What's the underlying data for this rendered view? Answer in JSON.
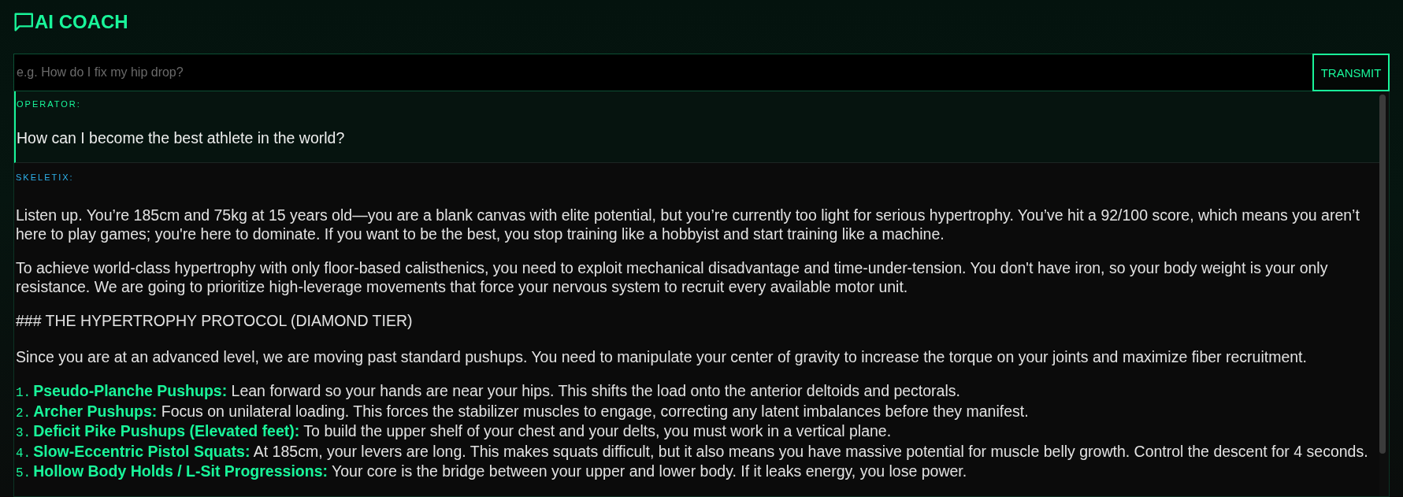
{
  "header": {
    "title": "AI COACH"
  },
  "composer": {
    "placeholder": "e.g. How do I fix my hip drop?",
    "button": "TRANSMIT"
  },
  "messages": [
    {
      "kind": "operator",
      "sender": "OPERATOR:",
      "blocks": [
        {
          "kind": "paragraph",
          "text": "How can I become the best athlete in the world?"
        }
      ]
    },
    {
      "kind": "coach",
      "sender": "SKELETIX:",
      "blocks": [
        {
          "kind": "paragraph",
          "text": "Listen up. You’re 185cm and 75kg at 15 years old—you are a blank canvas with elite potential, but you’re currently too light for serious hypertrophy. You’ve hit a 92/100 score, which means you aren’t here to play games; you're here to dominate. If you want to be the best, you stop training like a hobbyist and start training like a machine."
        },
        {
          "kind": "paragraph",
          "text": "To achieve world-class hypertrophy with only floor-based calisthenics, you need to exploit mechanical disadvantage and time-under-tension. You don't have iron, so your body weight is your only resistance. We are going to prioritize high-leverage movements that force your nervous system to recruit every available motor unit."
        },
        {
          "kind": "paragraph",
          "text": "### THE HYPERTROPHY PROTOCOL (DIAMOND TIER)"
        },
        {
          "kind": "paragraph",
          "text": "Since you are at an advanced level, we are moving past standard pushups. You need to manipulate your center of gravity to increase the torque on your joints and maximize fiber recruitment."
        },
        {
          "kind": "list",
          "items": [
            {
              "number": "1.",
              "text": "**Pseudo-Planche Pushups:** Lean forward so your hands are near your hips. This shifts the load onto the anterior deltoids and pectorals."
            },
            {
              "number": "2.",
              "text": "**Archer Pushups:** Focus on unilateral loading. This forces the stabilizer muscles to engage, correcting any latent imbalances before they manifest."
            },
            {
              "number": "3.",
              "text": "**Deficit Pike Pushups (Elevated feet):** To build the upper shelf of your chest and your delts, you must work in a vertical plane."
            },
            {
              "number": "4.",
              "text": "**Slow-Eccentric Pistol Squats:** At 185cm, your levers are long. This makes squats difficult, but it also means you have massive potential for muscle belly growth. Control the descent for 4 seconds."
            },
            {
              "number": "5.",
              "text": "**Hollow Body Holds / L-Sit Progressions:** Your core is the bridge between your upper and lower body. If it leaks energy, you lose power."
            }
          ]
        }
      ]
    }
  ]
}
